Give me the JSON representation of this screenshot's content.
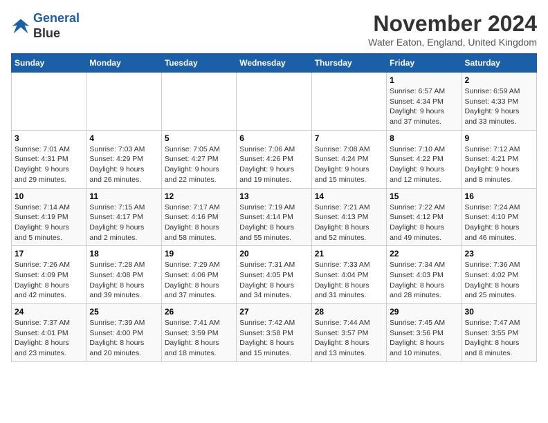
{
  "logo": {
    "line1": "General",
    "line2": "Blue"
  },
  "title": "November 2024",
  "subtitle": "Water Eaton, England, United Kingdom",
  "weekdays": [
    "Sunday",
    "Monday",
    "Tuesday",
    "Wednesday",
    "Thursday",
    "Friday",
    "Saturday"
  ],
  "weeks": [
    [
      {
        "day": "",
        "info": ""
      },
      {
        "day": "",
        "info": ""
      },
      {
        "day": "",
        "info": ""
      },
      {
        "day": "",
        "info": ""
      },
      {
        "day": "",
        "info": ""
      },
      {
        "day": "1",
        "info": "Sunrise: 6:57 AM\nSunset: 4:34 PM\nDaylight: 9 hours\nand 37 minutes."
      },
      {
        "day": "2",
        "info": "Sunrise: 6:59 AM\nSunset: 4:33 PM\nDaylight: 9 hours\nand 33 minutes."
      }
    ],
    [
      {
        "day": "3",
        "info": "Sunrise: 7:01 AM\nSunset: 4:31 PM\nDaylight: 9 hours\nand 29 minutes."
      },
      {
        "day": "4",
        "info": "Sunrise: 7:03 AM\nSunset: 4:29 PM\nDaylight: 9 hours\nand 26 minutes."
      },
      {
        "day": "5",
        "info": "Sunrise: 7:05 AM\nSunset: 4:27 PM\nDaylight: 9 hours\nand 22 minutes."
      },
      {
        "day": "6",
        "info": "Sunrise: 7:06 AM\nSunset: 4:26 PM\nDaylight: 9 hours\nand 19 minutes."
      },
      {
        "day": "7",
        "info": "Sunrise: 7:08 AM\nSunset: 4:24 PM\nDaylight: 9 hours\nand 15 minutes."
      },
      {
        "day": "8",
        "info": "Sunrise: 7:10 AM\nSunset: 4:22 PM\nDaylight: 9 hours\nand 12 minutes."
      },
      {
        "day": "9",
        "info": "Sunrise: 7:12 AM\nSunset: 4:21 PM\nDaylight: 9 hours\nand 8 minutes."
      }
    ],
    [
      {
        "day": "10",
        "info": "Sunrise: 7:14 AM\nSunset: 4:19 PM\nDaylight: 9 hours\nand 5 minutes."
      },
      {
        "day": "11",
        "info": "Sunrise: 7:15 AM\nSunset: 4:17 PM\nDaylight: 9 hours\nand 2 minutes."
      },
      {
        "day": "12",
        "info": "Sunrise: 7:17 AM\nSunset: 4:16 PM\nDaylight: 8 hours\nand 58 minutes."
      },
      {
        "day": "13",
        "info": "Sunrise: 7:19 AM\nSunset: 4:14 PM\nDaylight: 8 hours\nand 55 minutes."
      },
      {
        "day": "14",
        "info": "Sunrise: 7:21 AM\nSunset: 4:13 PM\nDaylight: 8 hours\nand 52 minutes."
      },
      {
        "day": "15",
        "info": "Sunrise: 7:22 AM\nSunset: 4:12 PM\nDaylight: 8 hours\nand 49 minutes."
      },
      {
        "day": "16",
        "info": "Sunrise: 7:24 AM\nSunset: 4:10 PM\nDaylight: 8 hours\nand 46 minutes."
      }
    ],
    [
      {
        "day": "17",
        "info": "Sunrise: 7:26 AM\nSunset: 4:09 PM\nDaylight: 8 hours\nand 42 minutes."
      },
      {
        "day": "18",
        "info": "Sunrise: 7:28 AM\nSunset: 4:08 PM\nDaylight: 8 hours\nand 39 minutes."
      },
      {
        "day": "19",
        "info": "Sunrise: 7:29 AM\nSunset: 4:06 PM\nDaylight: 8 hours\nand 37 minutes."
      },
      {
        "day": "20",
        "info": "Sunrise: 7:31 AM\nSunset: 4:05 PM\nDaylight: 8 hours\nand 34 minutes."
      },
      {
        "day": "21",
        "info": "Sunrise: 7:33 AM\nSunset: 4:04 PM\nDaylight: 8 hours\nand 31 minutes."
      },
      {
        "day": "22",
        "info": "Sunrise: 7:34 AM\nSunset: 4:03 PM\nDaylight: 8 hours\nand 28 minutes."
      },
      {
        "day": "23",
        "info": "Sunrise: 7:36 AM\nSunset: 4:02 PM\nDaylight: 8 hours\nand 25 minutes."
      }
    ],
    [
      {
        "day": "24",
        "info": "Sunrise: 7:37 AM\nSunset: 4:01 PM\nDaylight: 8 hours\nand 23 minutes."
      },
      {
        "day": "25",
        "info": "Sunrise: 7:39 AM\nSunset: 4:00 PM\nDaylight: 8 hours\nand 20 minutes."
      },
      {
        "day": "26",
        "info": "Sunrise: 7:41 AM\nSunset: 3:59 PM\nDaylight: 8 hours\nand 18 minutes."
      },
      {
        "day": "27",
        "info": "Sunrise: 7:42 AM\nSunset: 3:58 PM\nDaylight: 8 hours\nand 15 minutes."
      },
      {
        "day": "28",
        "info": "Sunrise: 7:44 AM\nSunset: 3:57 PM\nDaylight: 8 hours\nand 13 minutes."
      },
      {
        "day": "29",
        "info": "Sunrise: 7:45 AM\nSunset: 3:56 PM\nDaylight: 8 hours\nand 10 minutes."
      },
      {
        "day": "30",
        "info": "Sunrise: 7:47 AM\nSunset: 3:55 PM\nDaylight: 8 hours\nand 8 minutes."
      }
    ]
  ]
}
